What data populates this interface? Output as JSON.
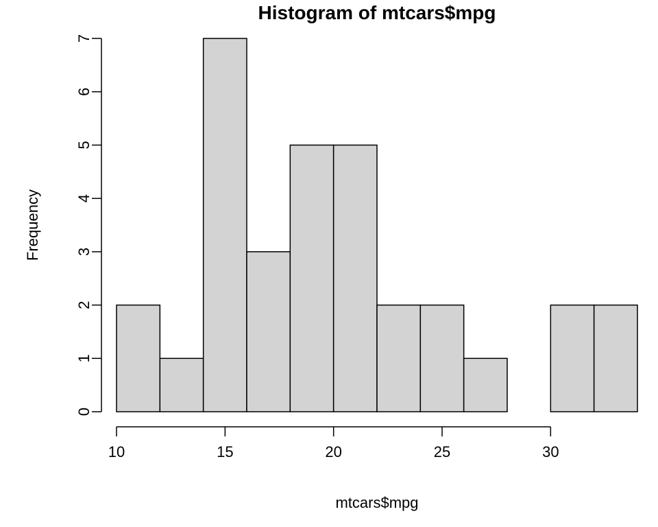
{
  "chart_data": {
    "type": "bar",
    "title": "Histogram of mtcars$mpg",
    "xlabel": "mtcars$mpg",
    "ylabel": "Frequency",
    "bin_edges": [
      10,
      12,
      14,
      16,
      18,
      20,
      22,
      24,
      26,
      28,
      30,
      32,
      34
    ],
    "values": [
      2,
      1,
      7,
      3,
      5,
      5,
      2,
      2,
      1,
      0,
      2,
      2
    ],
    "xlim": [
      10,
      34
    ],
    "ylim": [
      0,
      7
    ],
    "xticks": [
      10,
      15,
      20,
      25,
      30
    ],
    "yticks": [
      0,
      1,
      2,
      3,
      4,
      5,
      6,
      7
    ],
    "bar_color": "#d3d3d3"
  }
}
